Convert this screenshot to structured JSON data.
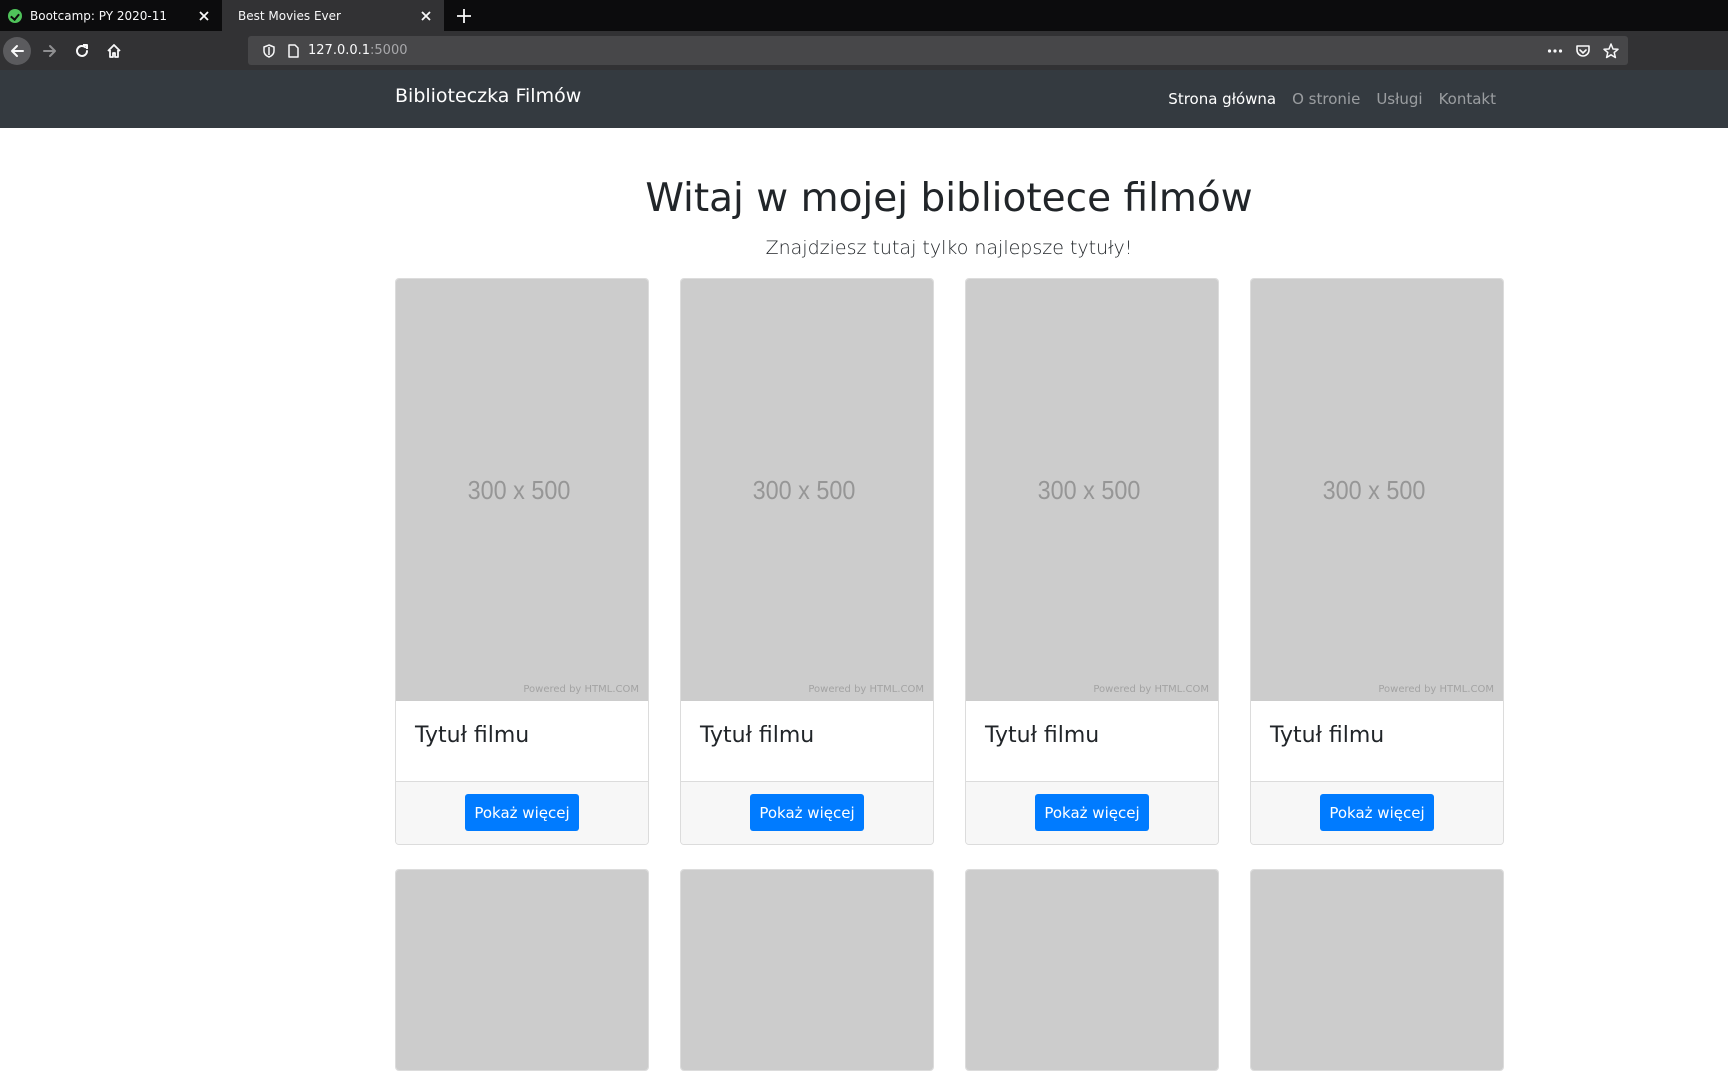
{
  "browser": {
    "tabs": [
      {
        "title": "Bootcamp: PY 2020-11",
        "active": false
      },
      {
        "title": "Best Movies Ever",
        "active": true
      }
    ],
    "url_host": "127.0.0.1",
    "url_port": ":5000"
  },
  "site": {
    "brand": "Biblioteczka Filmów",
    "nav": [
      {
        "label": "Strona główna",
        "active": true
      },
      {
        "label": "O stronie",
        "active": false
      },
      {
        "label": "Usługi",
        "active": false
      },
      {
        "label": "Kontakt",
        "active": false
      }
    ]
  },
  "hero": {
    "title": "Witaj w mojej bibliotece filmów",
    "subtitle": "Znajdziesz tutaj tylko najlepsze tytuły!"
  },
  "cards": [
    {
      "image_label": "300 x 500",
      "powered": "Powered by HTML.COM",
      "title": "Tytuł filmu",
      "button": "Pokaż więcej"
    },
    {
      "image_label": "300 x 500",
      "powered": "Powered by HTML.COM",
      "title": "Tytuł filmu",
      "button": "Pokaż więcej"
    },
    {
      "image_label": "300 x 500",
      "powered": "Powered by HTML.COM",
      "title": "Tytuł filmu",
      "button": "Pokaż więcej"
    },
    {
      "image_label": "300 x 500",
      "powered": "Powered by HTML.COM",
      "title": "Tytuł filmu",
      "button": "Pokaż więcej"
    }
  ],
  "colors": {
    "navbar": "#343a40",
    "primary": "#007bff",
    "placeholder": "#cccccc"
  }
}
